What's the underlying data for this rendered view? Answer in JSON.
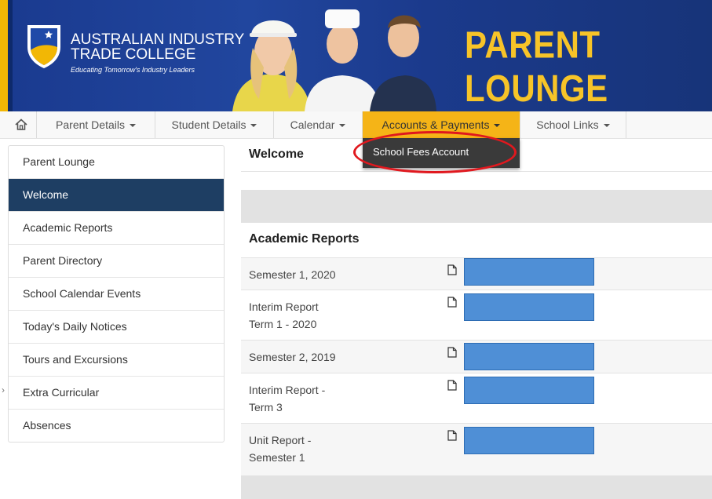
{
  "header": {
    "college_name_line1": "AUSTRALIAN INDUSTRY",
    "college_name_line2": "TRADE COLLEGE",
    "tagline": "Educating Tomorrow's Industry Leaders",
    "title": "PARENT LOUNGE",
    "title_color": "#f7c428",
    "banner_color": "#1b3a8c"
  },
  "nav": {
    "home_icon": "home-icon",
    "items": [
      {
        "label": "Parent Details"
      },
      {
        "label": "Student Details"
      },
      {
        "label": "Calendar"
      },
      {
        "label": "Accounts & Payments",
        "active": true
      },
      {
        "label": "School Links"
      }
    ],
    "active_color": "#f5b417"
  },
  "dropdown": {
    "items": [
      {
        "label": "School Fees Account"
      }
    ],
    "highlight_color": "#e0181e"
  },
  "sidebar": {
    "items": [
      {
        "label": "Parent Lounge"
      },
      {
        "label": "Welcome",
        "active": true
      },
      {
        "label": "Academic Reports"
      },
      {
        "label": "Parent Directory"
      },
      {
        "label": "School Calendar Events"
      },
      {
        "label": "Today's Daily Notices"
      },
      {
        "label": "Tours and Excursions"
      },
      {
        "label": "Extra Curricular"
      },
      {
        "label": "Absences"
      }
    ],
    "active_color": "#1e3e63"
  },
  "main": {
    "welcome_title": "Welcome",
    "reports_title": "Academic Reports",
    "reports": [
      {
        "line1": "Semester 1, 2020",
        "line2": ""
      },
      {
        "line1": "Interim Report",
        "line2": "Term 1 - 2020"
      },
      {
        "line1": "Semester 2, 2019",
        "line2": ""
      },
      {
        "line1": "Interim Report -",
        "line2": "Term 3"
      },
      {
        "line1": "Unit Report -",
        "line2": "Semester 1"
      }
    ],
    "redaction_color": "#4f8fd6"
  }
}
